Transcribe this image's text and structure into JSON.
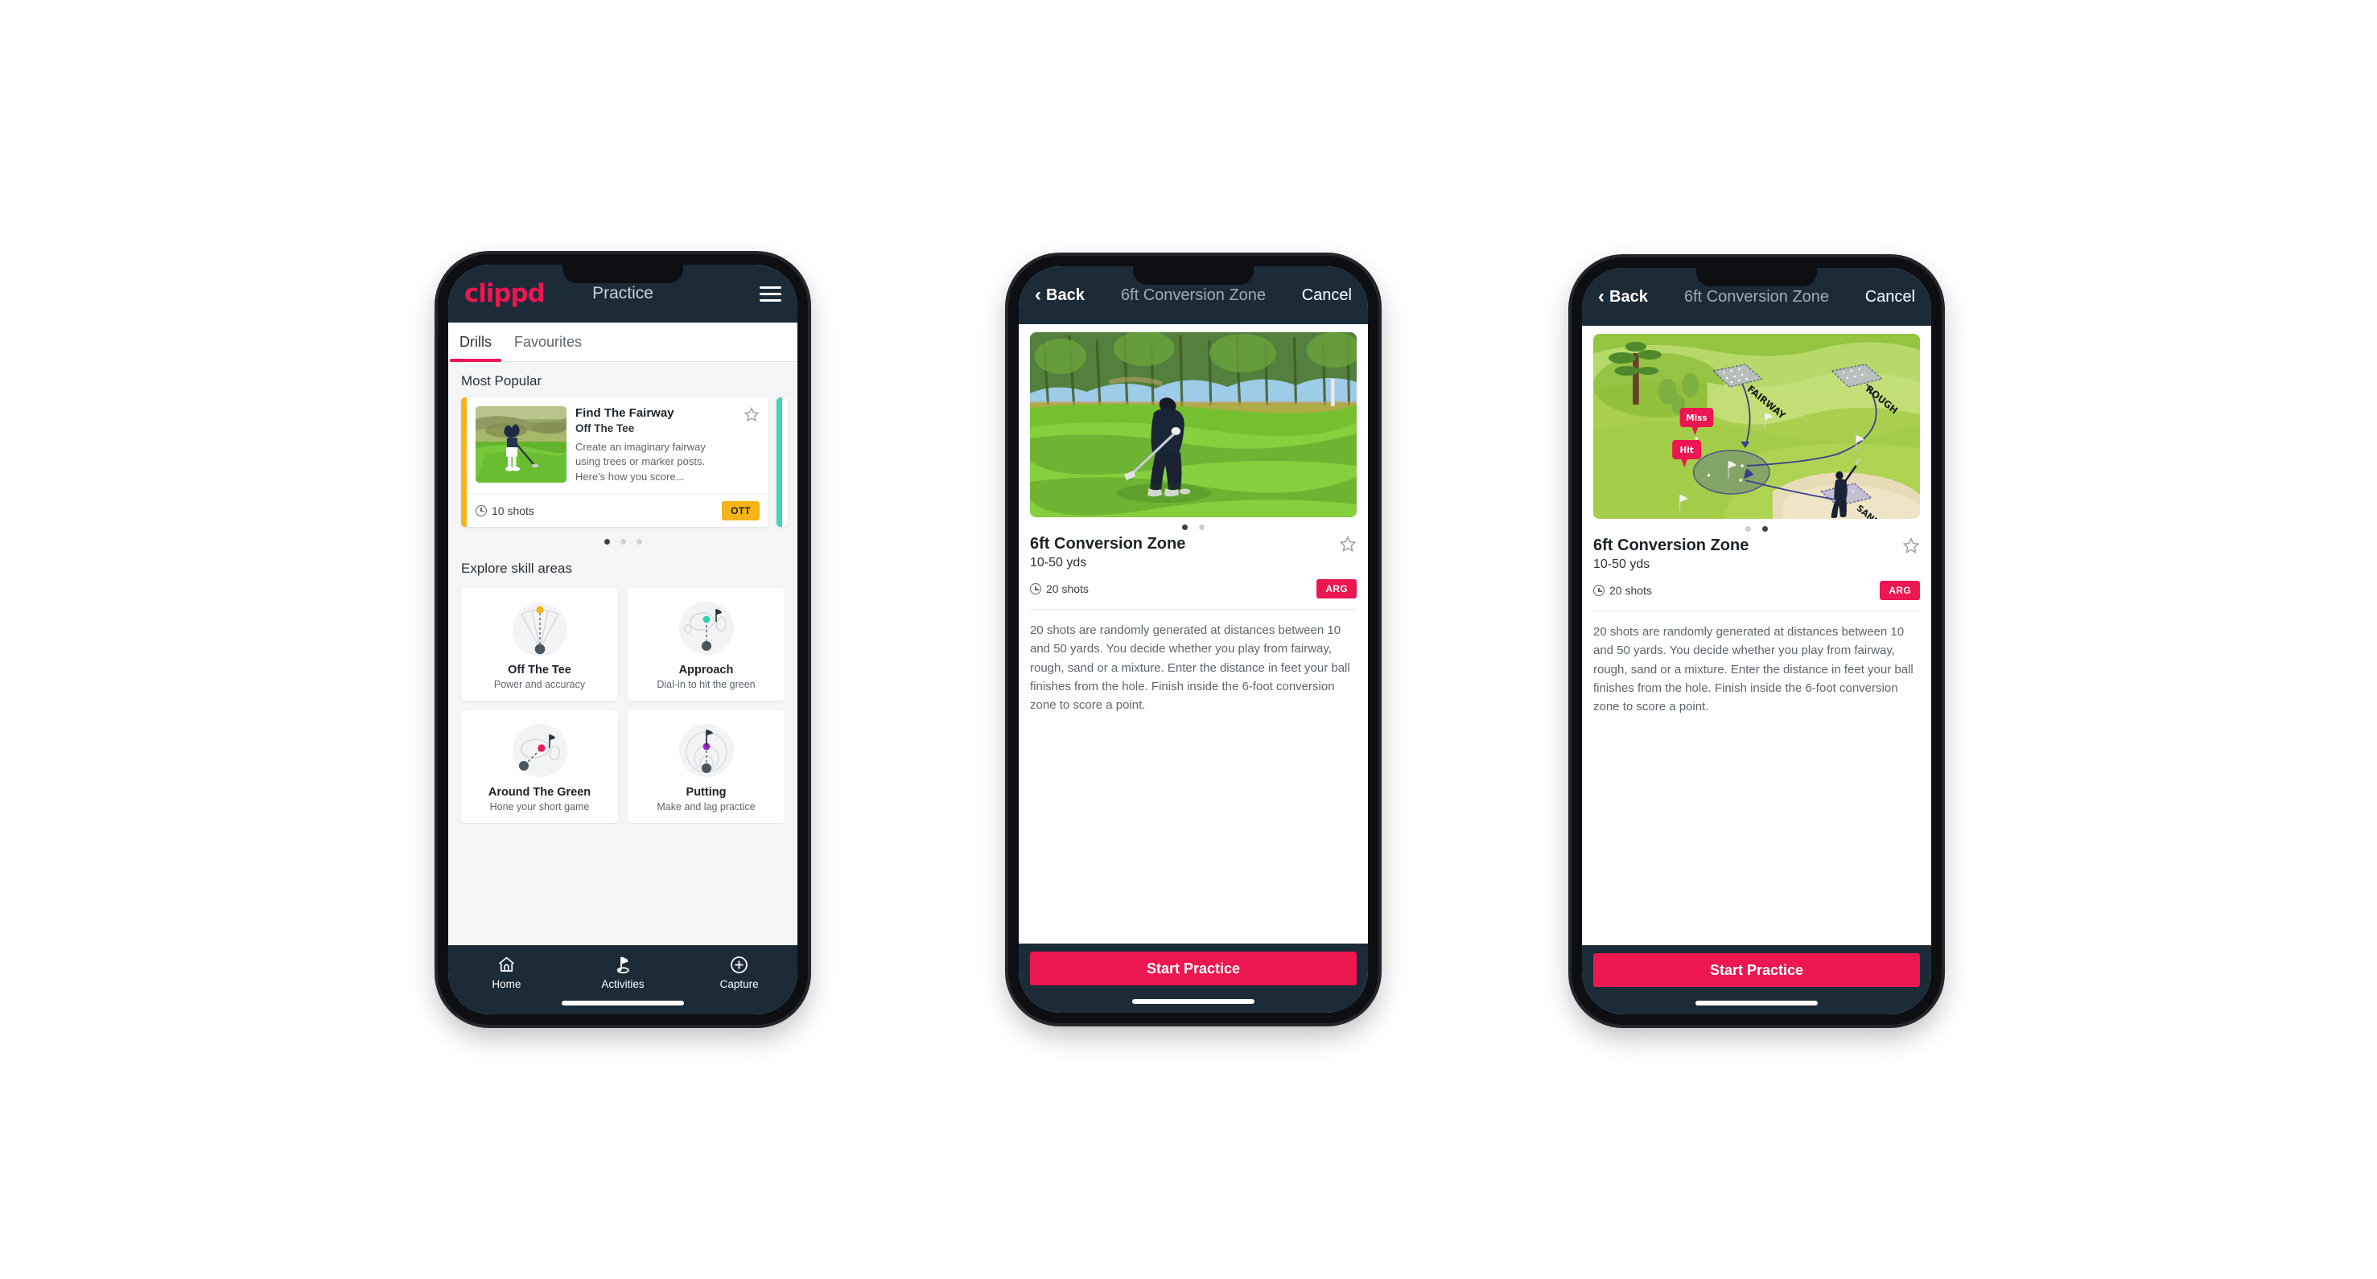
{
  "phone1": {
    "navbar": {
      "logo": "clippd",
      "title": "Practice",
      "menu_icon": "hamburger-icon"
    },
    "tabs": [
      {
        "label": "Drills",
        "active": true
      },
      {
        "label": "Favourites",
        "active": false
      }
    ],
    "most_popular": {
      "heading": "Most Popular",
      "card": {
        "title": "Find The Fairway",
        "subtitle": "Off The Tee",
        "description": "Create an imaginary fairway using trees or marker posts. Here's how you score...",
        "shots": "10 shots",
        "badge": "OTT",
        "badge_color": "#f5b417",
        "accent_color": "#f5b417",
        "next_accent_color": "#3fd6b4",
        "star_icon": "star-outline-icon",
        "clock_icon": "clock-icon"
      },
      "dots": [
        true,
        false,
        false
      ]
    },
    "explore": {
      "heading": "Explore skill areas",
      "cards": [
        {
          "name": "Off The Tee",
          "desc": "Power and accuracy",
          "icon": "tee-dispersion-icon",
          "dot_color": "#f5b417"
        },
        {
          "name": "Approach",
          "desc": "Dial-in to hit the green",
          "icon": "green-approach-icon",
          "dot_color": "#2ed3ae"
        },
        {
          "name": "Around The Green",
          "desc": "Hone your short game",
          "icon": "chip-to-green-icon",
          "dot_color": "#ec1651"
        },
        {
          "name": "Putting",
          "desc": "Make and lag practice",
          "icon": "putting-rings-icon",
          "dot_color": "#a21cd6"
        }
      ]
    },
    "tabbar": [
      {
        "label": "Home",
        "icon": "home-icon",
        "active": false
      },
      {
        "label": "Activities",
        "icon": "golf-flag-icon",
        "active": true
      },
      {
        "label": "Capture",
        "icon": "plus-circle-icon",
        "active": false
      }
    ]
  },
  "phone2": {
    "navbar": {
      "back": "Back",
      "title": "6ft Conversion Zone",
      "cancel": "Cancel",
      "back_icon": "chevron-left-icon"
    },
    "media": {
      "type": "photo",
      "alt": "golfer chipping on pine-lined course"
    },
    "dots": [
      true,
      false
    ],
    "detail": {
      "title": "6ft Conversion Zone",
      "yards": "10-50 yds",
      "shots": "20 shots",
      "badge": "ARG",
      "badge_color": "#ec1651",
      "star_icon": "star-outline-icon",
      "clock_icon": "clock-icon",
      "description": "20 shots are randomly generated at distances between 10 and 50 yards. You decide whether you play from fairway, rough, sand or a mixture. Enter the distance in feet your ball finishes from the hole. Finish inside the 6-foot conversion zone to score a point."
    },
    "cta": "Start Practice"
  },
  "phone3": {
    "navbar": {
      "back": "Back",
      "title": "6ft Conversion Zone",
      "cancel": "Cancel",
      "back_icon": "chevron-left-icon"
    },
    "media": {
      "type": "illustration",
      "labels": [
        "FAIRWAY",
        "ROUGH",
        "SAND"
      ],
      "callouts": [
        "Miss",
        "Hit"
      ],
      "callout_color": "#ec1651"
    },
    "dots": [
      false,
      true
    ],
    "detail": {
      "title": "6ft Conversion Zone",
      "yards": "10-50 yds",
      "shots": "20 shots",
      "badge": "ARG",
      "badge_color": "#ec1651",
      "star_icon": "star-outline-icon",
      "clock_icon": "clock-icon",
      "description": "20 shots are randomly generated at distances between 10 and 50 yards. You decide whether you play from fairway, rough, sand or a mixture. Enter the distance in feet your ball finishes from the hole. Finish inside the 6-foot conversion zone to score a point."
    },
    "cta": "Start Practice"
  }
}
